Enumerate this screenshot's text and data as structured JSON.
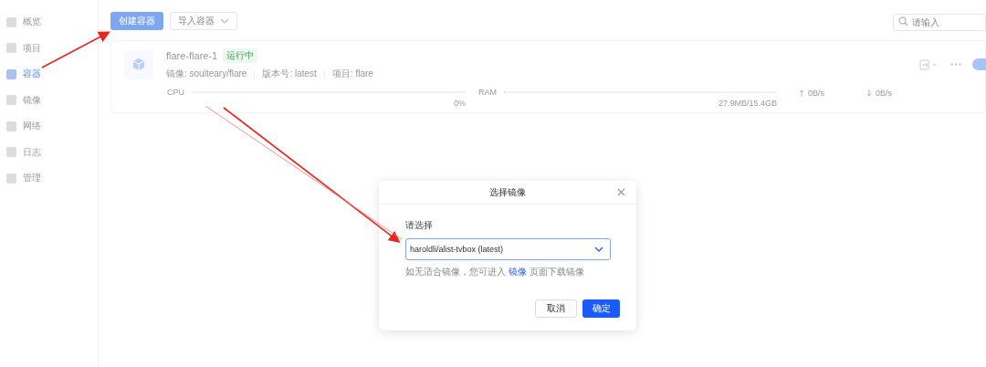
{
  "sidebar": {
    "items": [
      {
        "label": "概览",
        "selected": false
      },
      {
        "label": "项目",
        "selected": false
      },
      {
        "label": "容器",
        "selected": true
      },
      {
        "label": "镜像",
        "selected": false
      },
      {
        "label": "网络",
        "selected": false
      },
      {
        "label": "日志",
        "selected": false
      },
      {
        "label": "管理",
        "selected": false
      }
    ]
  },
  "toolbar": {
    "create_button": "创建容器",
    "import_button": "导入容器",
    "search": {
      "placeholder": "请输入"
    }
  },
  "container": {
    "name": "flare-flare-1",
    "status": "运行中",
    "image": "镜像: soulteary/flare",
    "version": "版本号: latest",
    "project": "项目: flare",
    "cpu": {
      "label": "CPU",
      "reading": "0%",
      "level": 0
    },
    "ram": {
      "label": "RAM",
      "reading": "27.9MB/15.4GB",
      "level": 0.002
    },
    "upload": "0B/s",
    "download": "0B/s",
    "switch_on": true
  },
  "dialog": {
    "title": "选择镜像",
    "field_label": "请选择",
    "value": "haroldli/alist-tvbox (latest)",
    "hint_before": "如无适合镜像，您可进入",
    "hint_link": "镜像",
    "hint_after": "页面下载镜像",
    "buttons": {
      "cancel": "取消",
      "ok": "确定"
    }
  }
}
